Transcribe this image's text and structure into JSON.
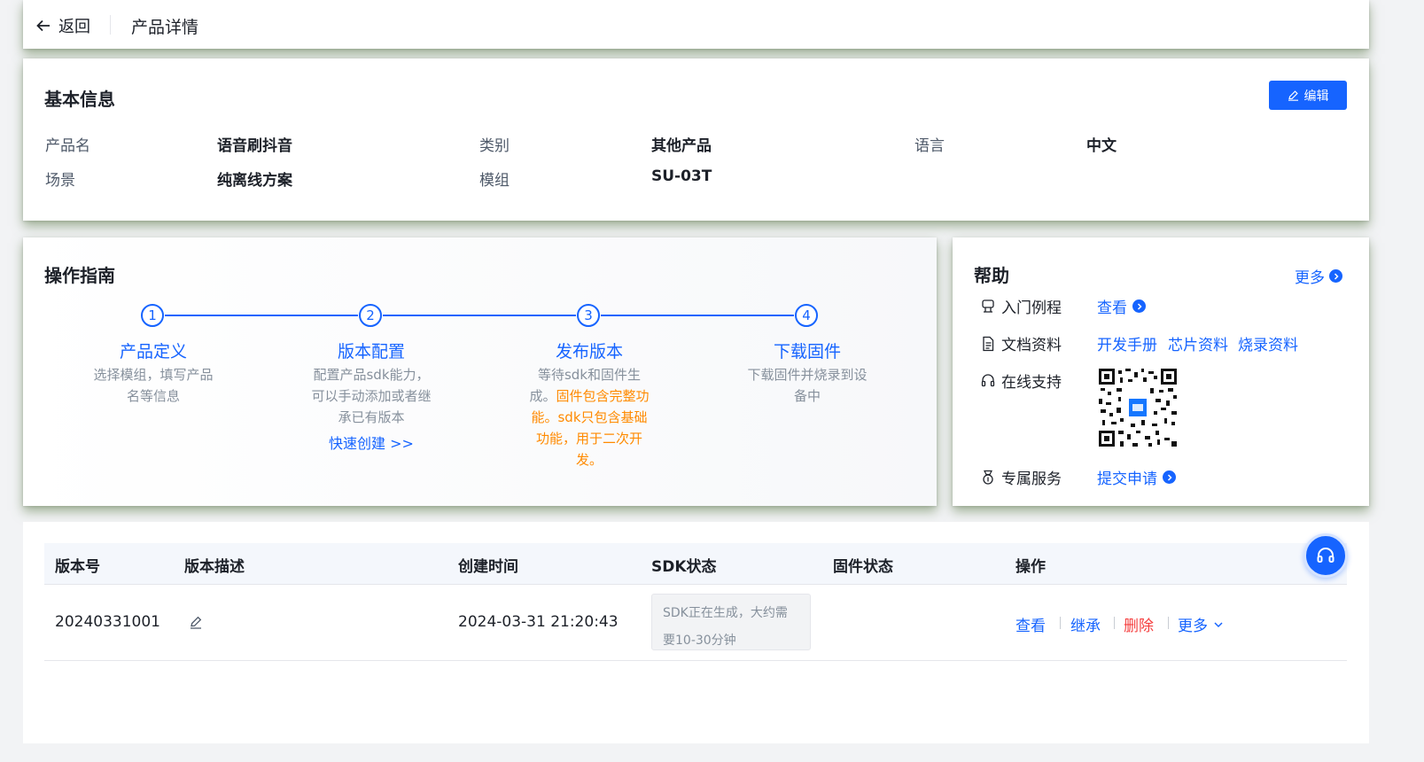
{
  "header": {
    "back_label": "返回",
    "title": "产品详情"
  },
  "basic": {
    "title": "基本信息",
    "edit_label": "编辑",
    "fields": [
      {
        "label": "产品名",
        "value": "语音刷抖音"
      },
      {
        "label": "类别",
        "value": "其他产品"
      },
      {
        "label": "语言",
        "value": "中文"
      },
      {
        "label": "场景",
        "value": "纯离线方案"
      },
      {
        "label": "模组",
        "value": "SU-03T"
      }
    ]
  },
  "guide": {
    "title": "操作指南",
    "steps": [
      {
        "num": "1",
        "title": "产品定义",
        "desc": [
          "选择模组，填写产品",
          "名等信息"
        ]
      },
      {
        "num": "2",
        "title": "版本配置",
        "desc": [
          "配置产品sdk能力，",
          "可以手动添加或者继",
          "承已有版本"
        ],
        "link": "快速创建 >>"
      },
      {
        "num": "3",
        "title": "发布版本",
        "desc_plain": "等待sdk和固件生",
        "desc_mixed_a": "成。",
        "desc_mixed_b": "固件包含完整功",
        "desc_orange": [
          "能。sdk只包含基础",
          "功能，用于二次开",
          "发。"
        ]
      },
      {
        "num": "4",
        "title": "下载固件",
        "desc": [
          "下载固件并烧录到设",
          "备中"
        ]
      }
    ]
  },
  "help": {
    "title": "帮助",
    "more": "更多",
    "rows": {
      "tutorial_label": "入门例程",
      "tutorial_link": "查看",
      "docs_label": "文档资料",
      "docs_links": [
        "开发手册",
        "芯片资料",
        "烧录资料"
      ],
      "support_label": "在线支持",
      "service_label": "专属服务",
      "service_link": "提交申请"
    }
  },
  "table": {
    "columns": [
      "版本号",
      "版本描述",
      "创建时间",
      "SDK状态",
      "固件状态",
      "操作"
    ],
    "rows": [
      {
        "version": "20240331001",
        "created": "2024-03-31 21:20:43",
        "sdk_status": [
          "SDK正在生成，大约需",
          "要10-30分钟"
        ],
        "firmware_status": "",
        "actions": [
          "查看",
          "继承",
          "删除",
          "更多"
        ]
      }
    ]
  },
  "colors": {
    "accent": "#1664ff",
    "danger": "#f53f3f",
    "warning": "#ff8a00"
  },
  "icons": [
    "arrow-left-icon",
    "edit-icon",
    "arrow-right-circle-icon",
    "tutorial-icon",
    "document-icon",
    "headset-icon",
    "medal-icon",
    "qr-code",
    "chevron-down-icon"
  ]
}
